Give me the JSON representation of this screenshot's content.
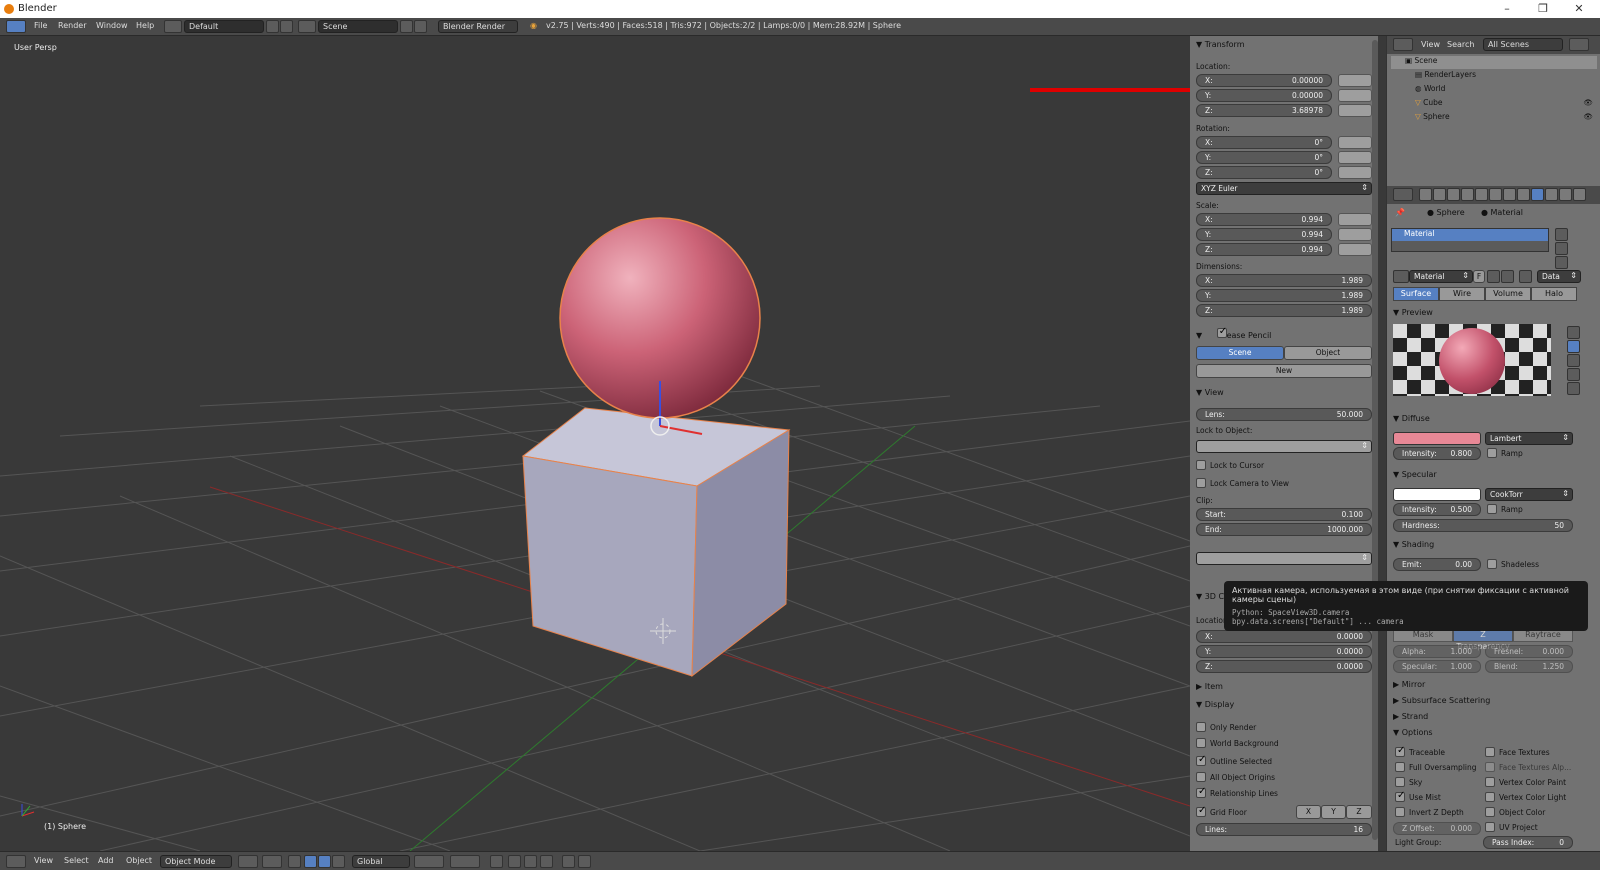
{
  "window": {
    "title": "Blender",
    "min": "–",
    "restore": "❐",
    "close": "✕"
  },
  "menu": {
    "items": [
      "File",
      "Render",
      "Window",
      "Help"
    ],
    "layout": "Default",
    "scene": "Scene",
    "engine": "Blender Render",
    "stats": "v2.75 | Verts:490 | Faces:518 | Tris:972 | Objects:2/2 | Lamps:0/0 | Mem:28.92M | Sphere"
  },
  "viewport": {
    "persp_label": "User Persp",
    "object_label": "(1) Sphere"
  },
  "transform": {
    "title": "Transform",
    "location_label": "Location:",
    "location": [
      {
        "axis": "X:",
        "value": "0.00000"
      },
      {
        "axis": "Y:",
        "value": "0.00000"
      },
      {
        "axis": "Z:",
        "value": "3.68978"
      }
    ],
    "rotation_label": "Rotation:",
    "rotation": [
      {
        "axis": "X:",
        "value": "0°"
      },
      {
        "axis": "Y:",
        "value": "0°"
      },
      {
        "axis": "Z:",
        "value": "0°"
      }
    ],
    "rotation_mode": "XYZ Euler",
    "scale_label": "Scale:",
    "scale": [
      {
        "axis": "X:",
        "value": "0.994"
      },
      {
        "axis": "Y:",
        "value": "0.994"
      },
      {
        "axis": "Z:",
        "value": "0.994"
      }
    ],
    "dimensions_label": "Dimensions:",
    "dimensions": [
      {
        "axis": "X:",
        "value": "1.989"
      },
      {
        "axis": "Y:",
        "value": "1.989"
      },
      {
        "axis": "Z:",
        "value": "1.989"
      }
    ]
  },
  "grease": {
    "title": "Grease Pencil",
    "scene": "Scene",
    "object": "Object",
    "new": "New"
  },
  "view": {
    "title": "View",
    "lens_label": "Lens:",
    "lens": "50.000",
    "lock_obj": "Lock to Object:",
    "lock_cursor": "Lock to Cursor",
    "lock_camera": "Lock Camera to View",
    "clip": "Clip:",
    "start_label": "Start:",
    "start": "0.100",
    "end_label": "End:",
    "end": "1000.000"
  },
  "cursor3d": {
    "title": "3D C",
    "location": "Location:",
    "vals": [
      {
        "axis": "X:",
        "value": "0.0000"
      },
      {
        "axis": "Y:",
        "value": "0.0000"
      },
      {
        "axis": "Z:",
        "value": "0.0000"
      }
    ]
  },
  "item_title": "Item",
  "display": {
    "title": "Display",
    "checks": [
      {
        "label": "Only Render",
        "on": false
      },
      {
        "label": "World Background",
        "on": false
      },
      {
        "label": "Outline Selected",
        "on": true
      },
      {
        "label": "All Object Origins",
        "on": false
      },
      {
        "label": "Relationship Lines",
        "on": true
      }
    ],
    "grid_floor": "Grid Floor",
    "axes": [
      "X",
      "Y",
      "Z"
    ],
    "lines_label": "Lines:",
    "lines": "16"
  },
  "tooltip": {
    "title": "Активная камера, используемая в этом виде (при снятии фиксации с активной камеры сцены)",
    "py1": "Python: SpaceView3D.camera",
    "py2": "bpy.data.screens[\"Default\"] ... camera"
  },
  "outliner": {
    "view": "View",
    "search": "Search",
    "filter": "All Scenes",
    "rows": [
      "Scene",
      "RenderLayers",
      "World",
      "Cube",
      "Sphere"
    ]
  },
  "props": {
    "crumb_obj": "Sphere",
    "crumb_mat": "Material",
    "slot": "Material",
    "mat_name": "Material",
    "f": "F",
    "data": "Data",
    "tabs": [
      "Surface",
      "Wire",
      "Volume",
      "Halo"
    ],
    "preview": "Preview",
    "diffuse": "Diffuse",
    "diffuse_shader": "Lambert",
    "diffuse_int_label": "Intensity:",
    "diffuse_int": "0.800",
    "ramp": "Ramp",
    "specular": "Specular",
    "spec_shader": "CookTorr",
    "spec_int_label": "Intensity:",
    "spec_int": "0.500",
    "hard_label": "Hardness:",
    "hardness": "50",
    "shading": "Shading",
    "emit_label": "Emit:",
    "emit": "0.00",
    "shadeless": "Shadeless",
    "transp_tabs": [
      "Mask",
      "Z Transparency",
      "Raytrace"
    ],
    "alpha_label": "Alpha:",
    "alpha": "1.000",
    "fresnel_label": "Fresnel:",
    "fresnel": "0.000",
    "spec2_label": "Specular:",
    "spec2": "1.000",
    "blend_label": "Blend:",
    "blend": "1.250",
    "collapsed": [
      "Mirror",
      "Subsurface Scattering",
      "Strand"
    ],
    "options": "Options",
    "opts_left": [
      {
        "label": "Traceable",
        "on": true
      },
      {
        "label": "Full Oversampling",
        "on": false
      },
      {
        "label": "Sky",
        "on": false
      },
      {
        "label": "Use Mist",
        "on": true
      },
      {
        "label": "Invert Z Depth",
        "on": false
      }
    ],
    "opts_right": [
      {
        "label": "Face Textures",
        "on": false
      },
      {
        "label": "Face Textures Alp...",
        "on": false
      },
      {
        "label": "Vertex Color Paint",
        "on": false
      },
      {
        "label": "Vertex Color Light",
        "on": false
      },
      {
        "label": "Object Color",
        "on": false
      },
      {
        "label": "UV Project",
        "on": false
      }
    ],
    "zoffset_label": "Z Offset:",
    "zoffset": "0.000",
    "lightgroup": "Light Group:",
    "pass_label": "Pass Index:",
    "pass": "0"
  },
  "status": {
    "view": "View",
    "select": "Select",
    "add": "Add",
    "object": "Object",
    "mode": "Object Mode",
    "orient": "Global"
  }
}
